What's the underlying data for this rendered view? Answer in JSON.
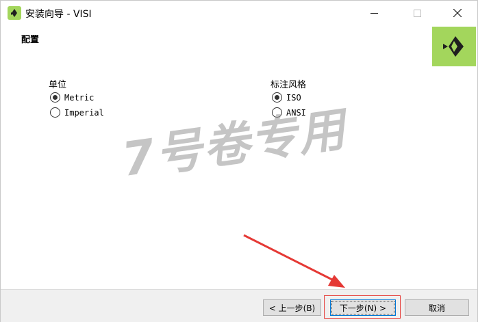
{
  "window": {
    "title": "安装向导 - VISI",
    "app_icon": "visi-logo-icon"
  },
  "header": {
    "title": "配置",
    "logo": "visi-brand-logo"
  },
  "unit_group": {
    "label": "单位",
    "options": [
      {
        "label": "Metric",
        "checked": true
      },
      {
        "label": "Imperial",
        "checked": false
      }
    ]
  },
  "dimension_group": {
    "label": "标注风格",
    "options": [
      {
        "label": "ISO",
        "checked": true
      },
      {
        "label": "ANSI",
        "checked": false
      }
    ]
  },
  "watermark": "7号卷专用",
  "footer": {
    "back_label": "< 上一步(B)",
    "next_label": "下一步(N) >",
    "cancel_label": "取消"
  },
  "annotation": {
    "arrow_color": "#e53935",
    "highlight_color": "#e53935"
  },
  "colors": {
    "brand_green": "#a3d65c"
  }
}
